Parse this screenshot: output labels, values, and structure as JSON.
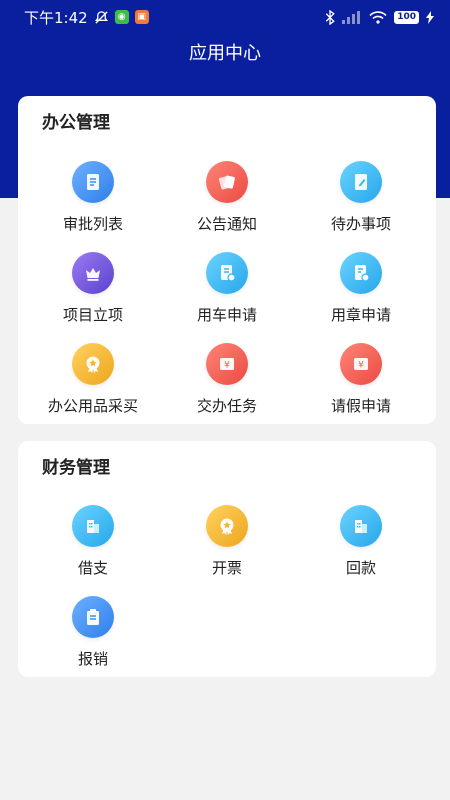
{
  "status_bar": {
    "time": "下午1:42",
    "battery": "100",
    "icons": [
      "alarm-off-icon",
      "wechat-icon",
      "notification-icon",
      "bluetooth-icon",
      "signal-icon",
      "wifi-icon",
      "battery-icon",
      "charging-icon"
    ]
  },
  "header": {
    "title": "应用中心"
  },
  "colors": {
    "header_bg": "#0a1f9e",
    "blue": "#3d8ff0",
    "red": "#f05a52",
    "cyan": "#38b7ef",
    "purple": "#6a52d8",
    "gold": "#f2b72e"
  },
  "sections": [
    {
      "title": "办公管理",
      "items": [
        {
          "label": "审批列表",
          "icon": "document-icon"
        },
        {
          "label": "公告通知",
          "icon": "notice-cards-icon"
        },
        {
          "label": "待办事项",
          "icon": "edit-note-icon"
        },
        {
          "label": "项目立项",
          "icon": "crown-icon"
        },
        {
          "label": "用车申请",
          "icon": "car-request-icon"
        },
        {
          "label": "用章申请",
          "icon": "seal-request-icon"
        },
        {
          "label": "办公用品采买",
          "icon": "badge-star-icon"
        },
        {
          "label": "交办任务",
          "icon": "yen-ticket-icon"
        },
        {
          "label": "请假申请",
          "icon": "yen-ticket-icon"
        }
      ]
    },
    {
      "title": "财务管理",
      "items": [
        {
          "label": "借支",
          "icon": "building-icon"
        },
        {
          "label": "开票",
          "icon": "badge-star-icon"
        },
        {
          "label": "回款",
          "icon": "building-icon"
        },
        {
          "label": "报销",
          "icon": "clipboard-icon"
        }
      ]
    }
  ]
}
